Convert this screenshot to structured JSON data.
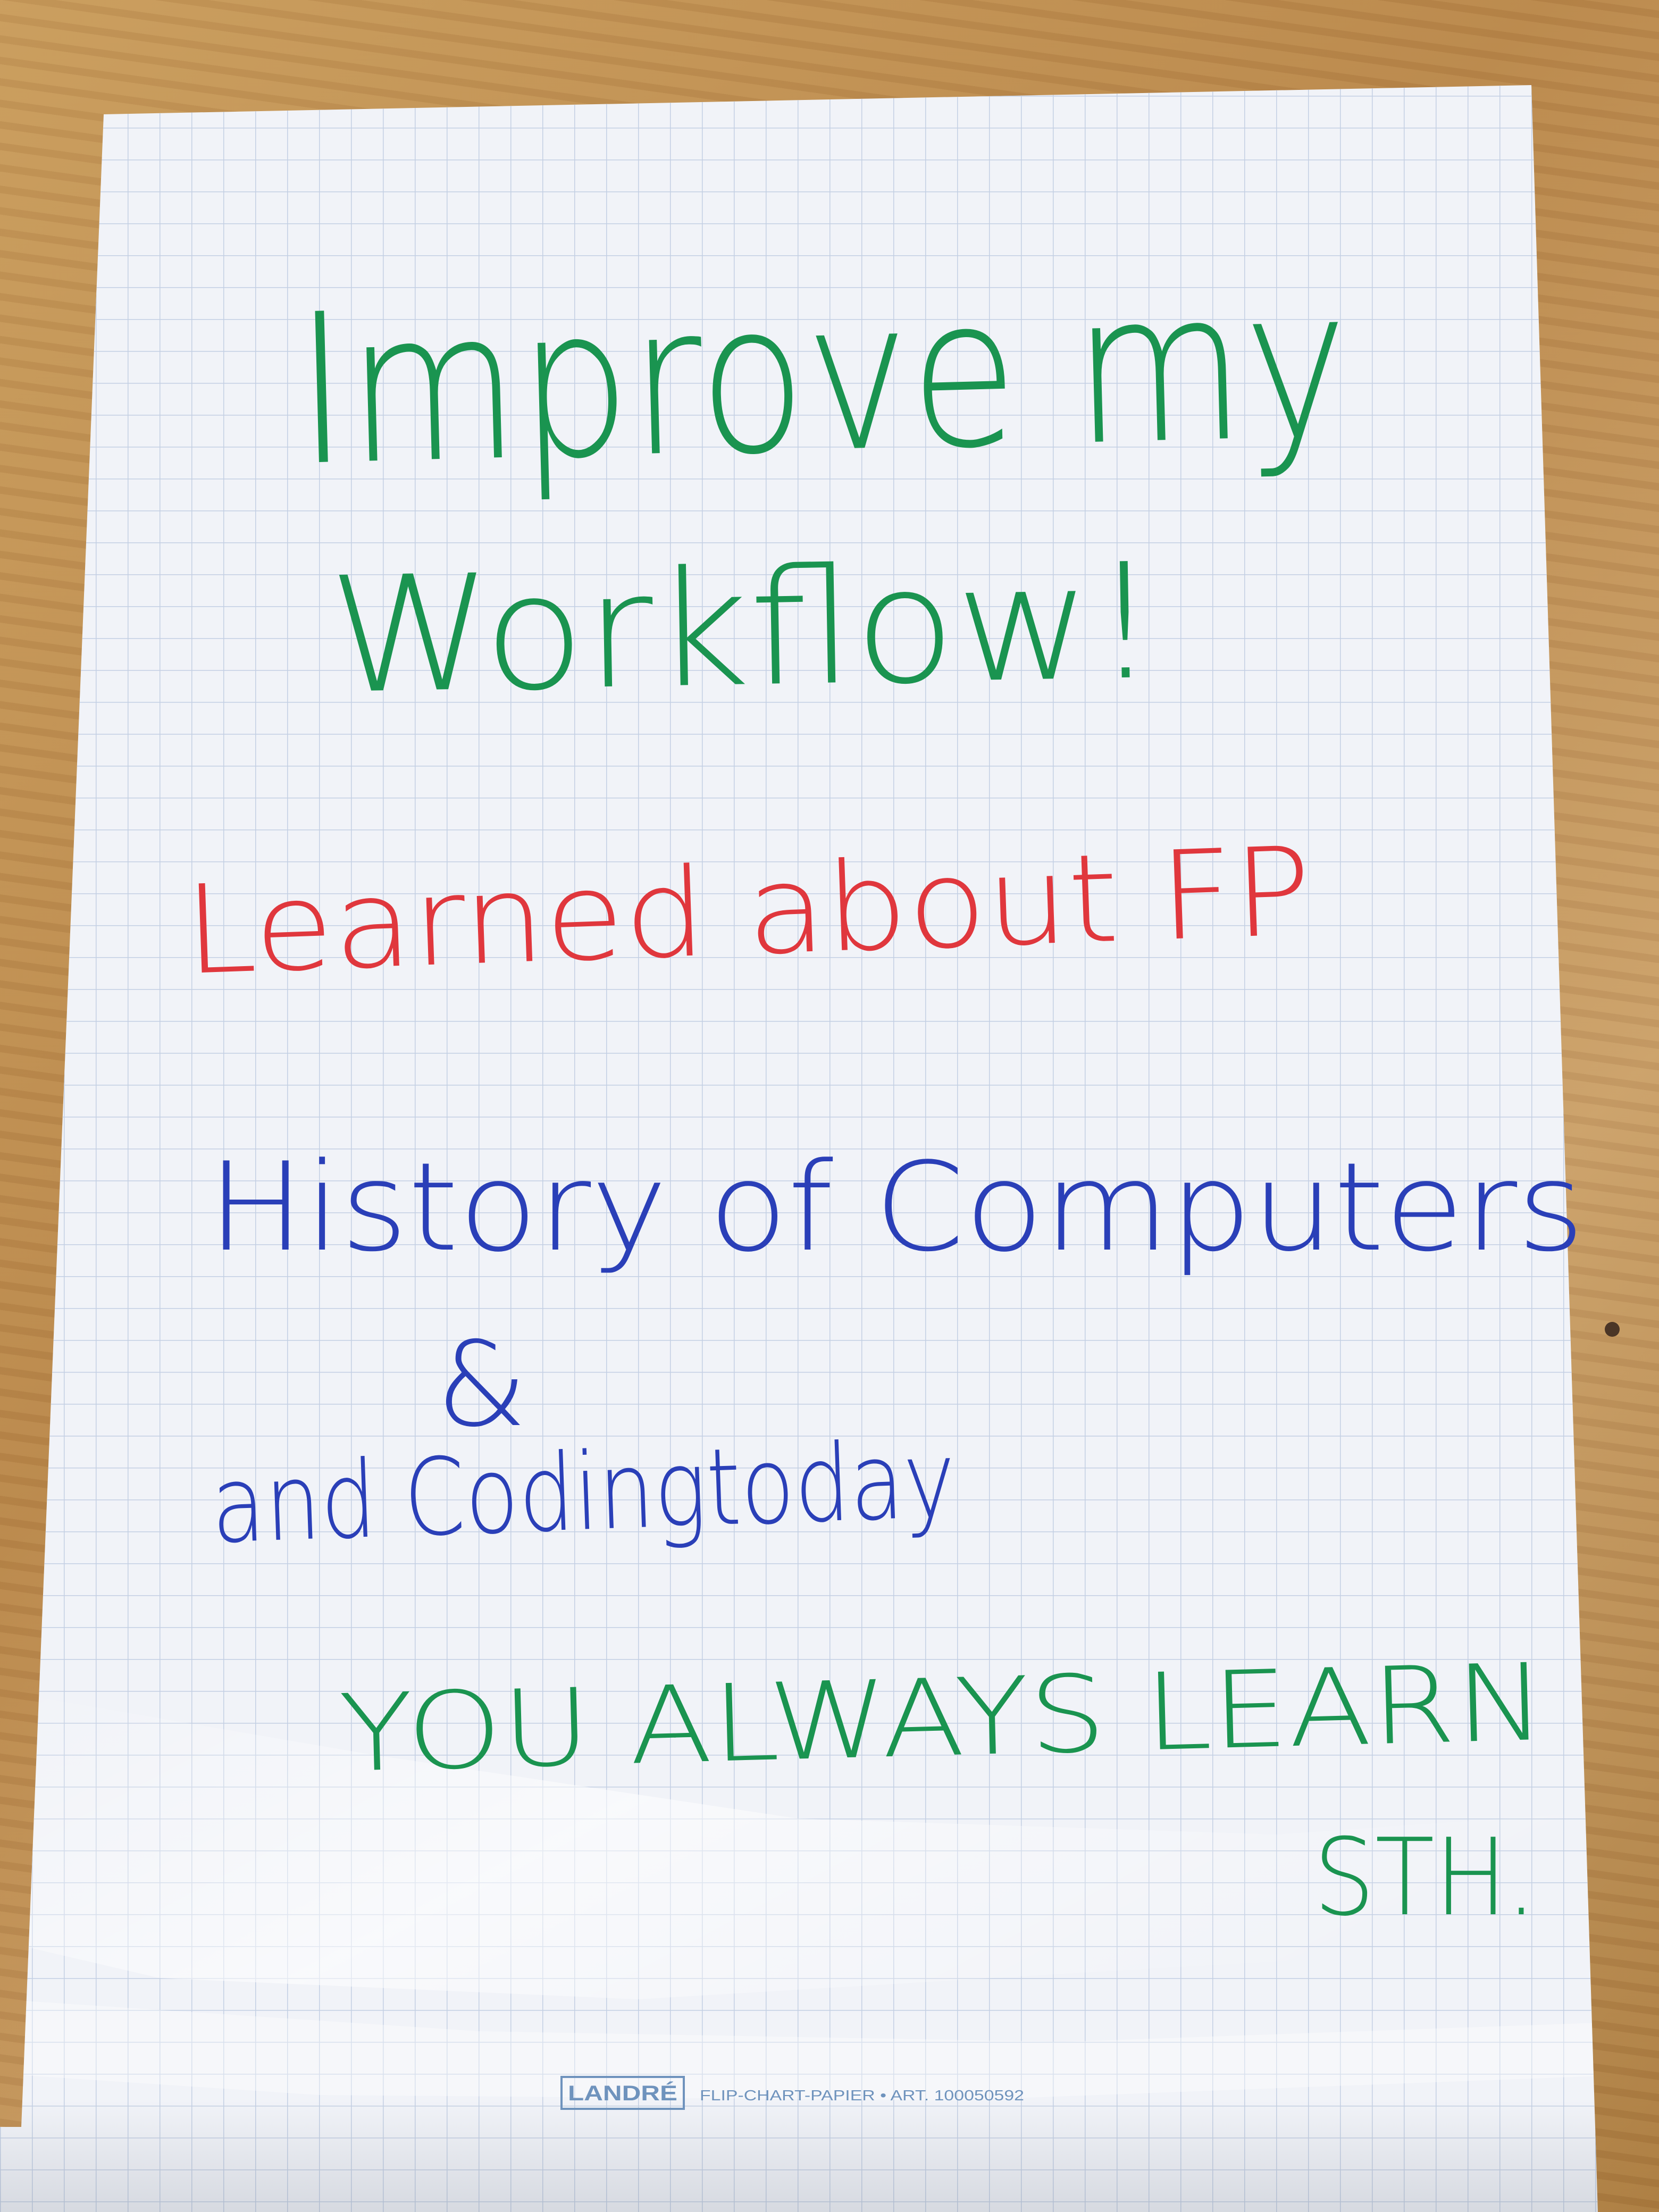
{
  "poster": {
    "title_line1": "Improve my",
    "title_line2": "Workflow!",
    "line_red": "Learned about FP",
    "line_blue1": "History of Computers",
    "ampersand": "&",
    "line_blue2": "and Codingtoday",
    "line_green1": "YOU ALWAYS LEARN",
    "line_green2": "STH."
  },
  "footer": {
    "brand": "LANDRÉ",
    "product": "FLIP-CHART-PAPIER • ART. 100050592"
  },
  "colors": {
    "green_marker": "#1a9450",
    "red_marker": "#e0373d",
    "blue_marker": "#2a3fb8",
    "paper": "#f1f3f8",
    "grid": "#c3cfe3",
    "floor": "#c89b5c"
  }
}
